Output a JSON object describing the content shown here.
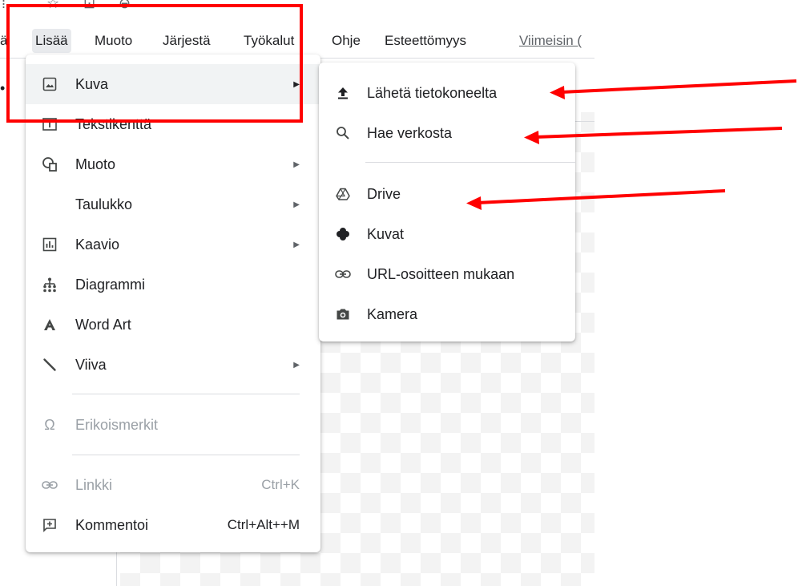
{
  "menubar": {
    "items": [
      "ä",
      "Lisää",
      "Muoto",
      "Järjestä",
      "Työkalut",
      "Ohje",
      "Esteettömyys"
    ],
    "last_edit": "Viimeisin ("
  },
  "insert_menu": {
    "items": [
      {
        "icon": "image-icon",
        "label": "Kuva",
        "has_submenu": true
      },
      {
        "icon": "text-box-icon",
        "label": "Tekstikenttä"
      },
      {
        "icon": "shape-icon",
        "label": "Muoto",
        "has_submenu": true
      },
      {
        "icon": "",
        "label": "Taulukko",
        "has_submenu": true
      },
      {
        "icon": "chart-icon",
        "label": "Kaavio",
        "has_submenu": true
      },
      {
        "icon": "diagram-icon",
        "label": "Diagrammi"
      },
      {
        "icon": "word-art-icon",
        "label": "Word Art"
      },
      {
        "icon": "line-icon",
        "label": "Viiva",
        "has_submenu": true
      },
      {
        "icon": "omega-icon",
        "label": "Erikoismerkit",
        "disabled": true
      },
      {
        "icon": "link-icon",
        "label": "Linkki",
        "shortcut": "Ctrl+K",
        "disabled": true
      },
      {
        "icon": "comment-icon",
        "label": "Kommentoi",
        "shortcut": "Ctrl+Alt++M"
      }
    ]
  },
  "image_submenu": {
    "items": [
      {
        "icon": "upload-icon",
        "label": "Lähetä tietokoneelta"
      },
      {
        "icon": "search-icon",
        "label": "Hae verkosta"
      },
      {
        "icon": "drive-icon",
        "label": "Drive"
      },
      {
        "icon": "photos-icon",
        "label": "Kuvat"
      },
      {
        "icon": "link-icon",
        "label": "URL-osoitteen mukaan"
      },
      {
        "icon": "camera-icon",
        "label": "Kamera"
      }
    ]
  },
  "colors": {
    "annotation": "#ff0000",
    "hover": "#f1f3f4"
  }
}
